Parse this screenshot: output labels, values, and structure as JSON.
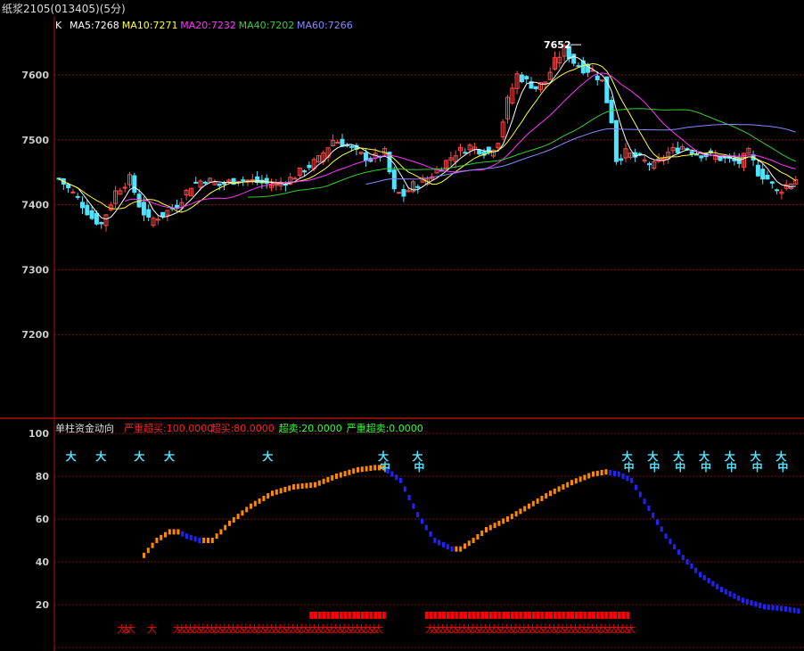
{
  "window": {
    "title": "纸浆2105(013405)(5分)"
  },
  "colors": {
    "up": "#ff4a4a",
    "down": "#50e3ff",
    "ma5": "#ffffff",
    "ma10": "#ffff33",
    "ma20": "#ff33ff",
    "ma40": "#33cc33",
    "ma60": "#8888ff",
    "grid": "#7a1010",
    "axis_text": "#cccccc",
    "rising": "#ff8800",
    "falling": "#2222ff",
    "signal": "#50e3ff",
    "strong": "#ff0000"
  },
  "chart_data": [
    {
      "type": "candlestick",
      "indicator_label": "K",
      "legend": [
        {
          "key": "ma5",
          "label": "MA5:7268"
        },
        {
          "key": "ma10",
          "label": "MA10:7271"
        },
        {
          "key": "ma20",
          "label": "MA20:7232"
        },
        {
          "key": "ma40",
          "label": "MA40:7202"
        },
        {
          "key": "ma60",
          "label": "MA60:7266"
        }
      ],
      "y_ticks": [
        7600,
        7500,
        7400,
        7300,
        7200
      ],
      "ylim": [
        7120,
        7680
      ],
      "high_annotation": {
        "label": "7652",
        "value": 7652
      },
      "price_path": [
        [
          0,
          7440
        ],
        [
          4,
          7410
        ],
        [
          7,
          7380
        ],
        [
          9,
          7370
        ],
        [
          12,
          7420
        ],
        [
          15,
          7440
        ],
        [
          17,
          7400
        ],
        [
          19,
          7375
        ],
        [
          22,
          7385
        ],
        [
          25,
          7400
        ],
        [
          28,
          7430
        ],
        [
          31,
          7440
        ],
        [
          34,
          7430
        ],
        [
          38,
          7440
        ],
        [
          42,
          7435
        ],
        [
          46,
          7430
        ],
        [
          49,
          7440
        ],
        [
          52,
          7455
        ],
        [
          55,
          7470
        ],
        [
          58,
          7500
        ],
        [
          60,
          7495
        ],
        [
          63,
          7480
        ],
        [
          66,
          7470
        ],
        [
          69,
          7480
        ],
        [
          71,
          7420
        ],
        [
          73,
          7415
        ],
        [
          75,
          7430
        ],
        [
          78,
          7440
        ],
        [
          81,
          7460
        ],
        [
          84,
          7480
        ],
        [
          87,
          7490
        ],
        [
          89,
          7485
        ],
        [
          91,
          7480
        ],
        [
          93,
          7500
        ],
        [
          95,
          7560
        ],
        [
          97,
          7600
        ],
        [
          99,
          7590
        ],
        [
          101,
          7580
        ],
        [
          103,
          7590
        ],
        [
          105,
          7620
        ],
        [
          107,
          7640
        ],
        [
          109,
          7620
        ],
        [
          111,
          7610
        ],
        [
          113,
          7605
        ],
        [
          115,
          7590
        ],
        [
          117,
          7530
        ],
        [
          118,
          7470
        ],
        [
          120,
          7480
        ],
        [
          123,
          7470
        ],
        [
          126,
          7460
        ],
        [
          129,
          7480
        ],
        [
          132,
          7490
        ],
        [
          135,
          7480
        ],
        [
          138,
          7475
        ],
        [
          141,
          7470
        ],
        [
          144,
          7465
        ],
        [
          146,
          7480
        ],
        [
          148,
          7450
        ],
        [
          150,
          7440
        ],
        [
          152,
          7420
        ],
        [
          154,
          7430
        ],
        [
          156,
          7440
        ]
      ],
      "ma_ranges": {
        "ma5": [
          0,
          156
        ],
        "ma10": [
          0,
          156
        ],
        "ma20": [
          14,
          156
        ],
        "ma40": [
          40,
          156
        ],
        "ma60": [
          65,
          156
        ]
      }
    },
    {
      "type": "line",
      "title": "单柱资金动向",
      "levels": [
        {
          "label": "严重超买:100.0000",
          "value": 100,
          "color": "#ff2020"
        },
        {
          "label": "超买:80.0000",
          "value": 80,
          "color": "#ff2020"
        },
        {
          "label": "超卖:20.0000",
          "value": 20,
          "color": "#33ff33"
        },
        {
          "label": "严重超卖:0.0000",
          "value": 0,
          "color": "#33ff33"
        }
      ],
      "y_ticks": [
        100,
        80,
        60,
        40,
        20
      ],
      "ylim": [
        0,
        105
      ],
      "series_points": [
        [
          20,
          43
        ],
        [
          23,
          50
        ],
        [
          26,
          54
        ],
        [
          28,
          54
        ],
        [
          30,
          52
        ],
        [
          33,
          50
        ],
        [
          36,
          50
        ],
        [
          40,
          58
        ],
        [
          45,
          66
        ],
        [
          50,
          72
        ],
        [
          55,
          75
        ],
        [
          60,
          76
        ],
        [
          65,
          80
        ],
        [
          70,
          83
        ],
        [
          74,
          84
        ],
        [
          76,
          84
        ],
        [
          80,
          78
        ],
        [
          84,
          62
        ],
        [
          88,
          50
        ],
        [
          92,
          46
        ],
        [
          94,
          46
        ],
        [
          97,
          50
        ],
        [
          100,
          55
        ],
        [
          105,
          60
        ],
        [
          110,
          66
        ],
        [
          115,
          72
        ],
        [
          120,
          77
        ],
        [
          125,
          81
        ],
        [
          128,
          82
        ],
        [
          131,
          81
        ],
        [
          134,
          78
        ],
        [
          138,
          65
        ],
        [
          142,
          52
        ],
        [
          146,
          42
        ],
        [
          150,
          34
        ],
        [
          155,
          27
        ],
        [
          160,
          22
        ],
        [
          165,
          19
        ],
        [
          170,
          18
        ],
        [
          173,
          17
        ]
      ],
      "signal_label_top": "大",
      "signal_label_mid": "中",
      "strong_label": "大",
      "top_signals": [
        {
          "i": 2,
          "mid": false
        },
        {
          "i": 9,
          "mid": false
        },
        {
          "i": 18,
          "mid": false
        },
        {
          "i": 25,
          "mid": false
        },
        {
          "i": 48,
          "mid": false
        },
        {
          "i": 75,
          "mid": true
        },
        {
          "i": 83,
          "mid": true
        },
        {
          "i": 132,
          "mid": true
        },
        {
          "i": 138,
          "mid": true
        },
        {
          "i": 144,
          "mid": true
        },
        {
          "i": 150,
          "mid": true
        },
        {
          "i": 156,
          "mid": true
        },
        {
          "i": 162,
          "mid": true
        },
        {
          "i": 168,
          "mid": true
        }
      ],
      "bar_ranges": [
        [
          59,
          76
        ],
        [
          86,
          133
        ]
      ],
      "bottom_ranges": [
        [
          14,
          16
        ],
        [
          21,
          21
        ],
        [
          27,
          74
        ],
        [
          86,
          133
        ]
      ]
    }
  ]
}
